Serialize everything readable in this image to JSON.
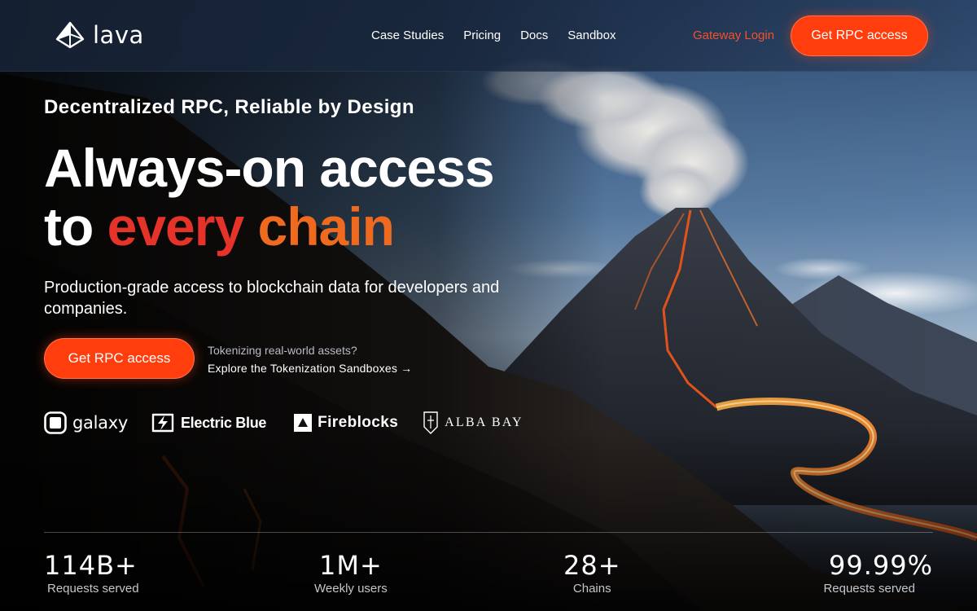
{
  "header": {
    "brand": "lava",
    "nav": [
      "Case Studies",
      "Pricing",
      "Docs",
      "Sandbox"
    ],
    "gateway_login": "Gateway Login",
    "cta": "Get RPC access"
  },
  "hero": {
    "eyebrow": "Decentralized RPC, Reliable by Design",
    "headline_line1": "Always-on access",
    "headline_to": "to",
    "headline_every": "every",
    "headline_chain": "chain",
    "subtitle": "Production-grade access to blockchain data for developers and companies.",
    "cta": "Get RPC access",
    "rwa_question": "Tokenizing real-world assets?",
    "rwa_link": "Explore the Tokenization Sandboxes →"
  },
  "partners": [
    "galaxy",
    "Electric Blue",
    "Fireblocks",
    "ALBA BAY"
  ],
  "stats": [
    {
      "value": "114B+",
      "label": "Requests served"
    },
    {
      "value": "1M+",
      "label": "Weekly users"
    },
    {
      "value": "28+",
      "label": "Chains"
    },
    {
      "value": "99.99%",
      "label": "Requests served"
    }
  ],
  "colors": {
    "accent": "#ff3d0d",
    "gateway": "#f2512c",
    "every": "#e5332a",
    "chain": "#ee6a1f"
  },
  "icons": {
    "brand": "lava-prism-icon",
    "galaxy": "galaxy-square-icon",
    "electric_blue": "lightning-badge-icon",
    "fireblocks": "fireblocks-triangle-icon",
    "alba_bay": "alba-bay-crest-icon"
  }
}
